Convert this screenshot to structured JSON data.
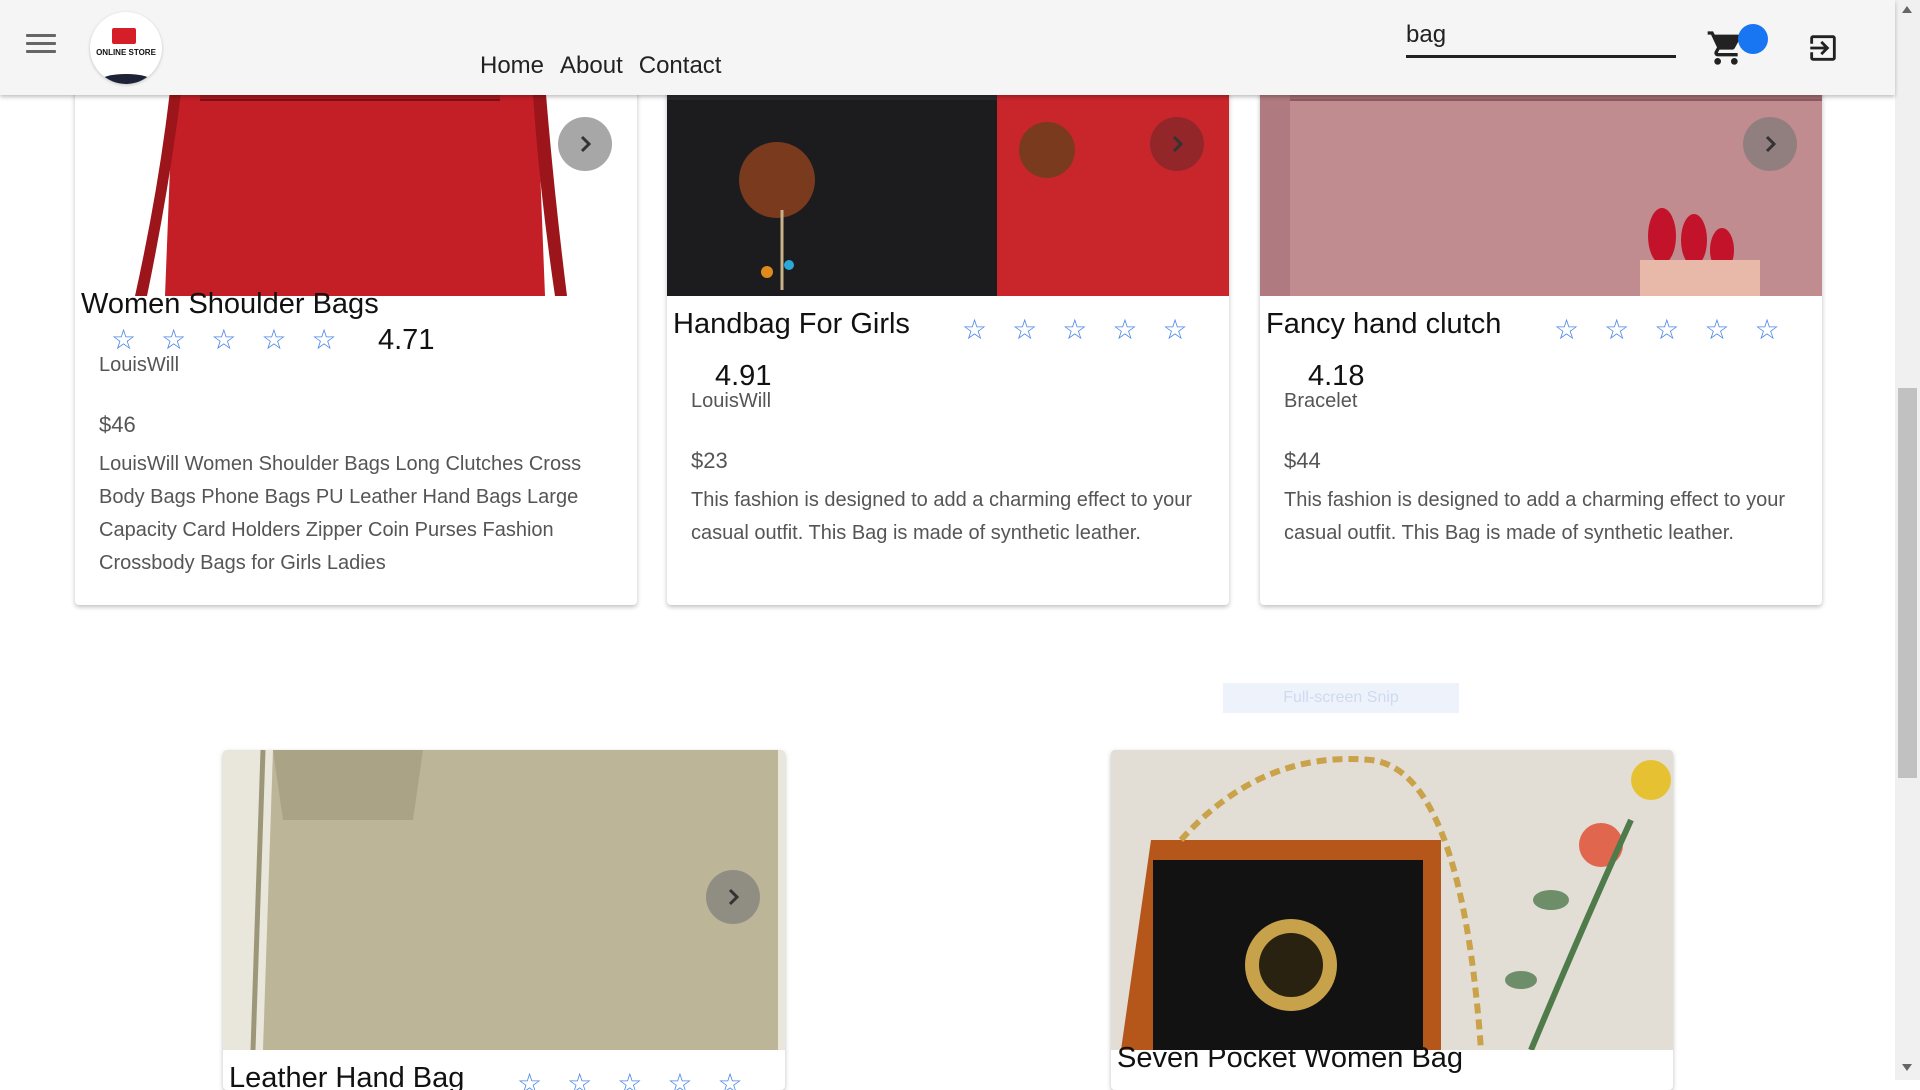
{
  "header": {
    "nav": [
      "Home",
      "About",
      "Contact"
    ],
    "search_value": "bag",
    "logo_text": "ONLINE STORE"
  },
  "products": [
    {
      "title": "Women Shoulder Bags",
      "rating": "4.71",
      "brand": "LouisWill",
      "price": "$46",
      "description": "LouisWill Women Shoulder Bags Long Clutches Cross Body Bags Phone Bags PU Leather Hand Bags Large Capacity Card Holders Zipper Coin Purses Fashion Crossbody Bags for Girls Ladies",
      "stars": 5
    },
    {
      "title": "Handbag For Girls",
      "rating": "4.91",
      "brand": "LouisWill",
      "price": "$23",
      "description": "This fashion is designed to add a charming effect to your casual outfit. This Bag is made of synthetic leather.",
      "stars": 5
    },
    {
      "title": "Fancy hand clutch",
      "rating": "4.18",
      "brand": "Bracelet",
      "price": "$44",
      "description": "This fashion is designed to add a charming effect to your casual outfit. This Bag is made of synthetic leather.",
      "stars": 5
    },
    {
      "title": "Leather Hand Bag",
      "stars": 5
    },
    {
      "title": "Seven Pocket Women Bag"
    }
  ],
  "star_glyph": "☆",
  "overlay": {
    "snip_label": "Full-screen Snip"
  },
  "colors": {
    "accent": "#1976f2",
    "star": "#4a86e8"
  }
}
